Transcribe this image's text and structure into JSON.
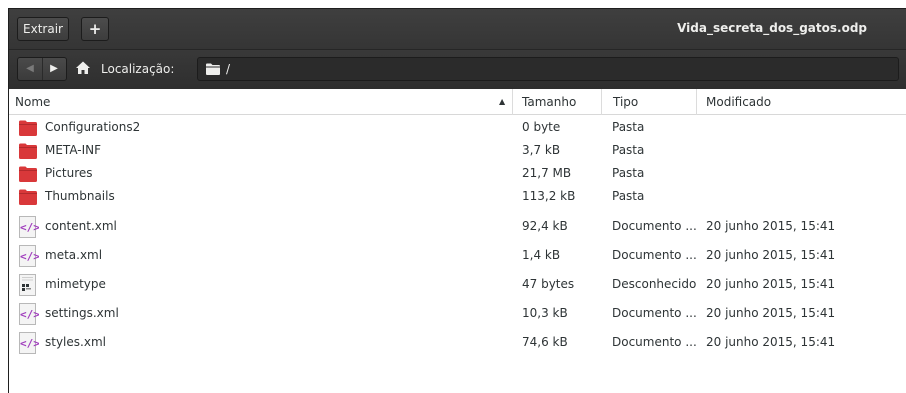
{
  "headerbar": {
    "extract_label": "Extrair",
    "add_label": "+",
    "title": "Vida_secreta_dos_gatos.odp"
  },
  "toolbar": {
    "location_label": "Localização:",
    "path": "/"
  },
  "columns": {
    "name": "Nome",
    "size": "Tamanho",
    "type": "Tipo",
    "modified": "Modificado"
  },
  "files": [
    {
      "name": "Configurations2",
      "size": "0 byte",
      "type": "Pasta",
      "modified": "",
      "icon": "folder-icon"
    },
    {
      "name": "META-INF",
      "size": "3,7 kB",
      "type": "Pasta",
      "modified": "",
      "icon": "folder-icon"
    },
    {
      "name": "Pictures",
      "size": "21,7 MB",
      "type": "Pasta",
      "modified": "",
      "icon": "folder-icon"
    },
    {
      "name": "Thumbnails",
      "size": "113,2 kB",
      "type": "Pasta",
      "modified": "",
      "icon": "folder-icon"
    },
    {
      "name": "content.xml",
      "size": "92,4 kB",
      "type": "Documento ...",
      "modified": "20 junho 2015, 15:41",
      "icon": "xml-file-icon"
    },
    {
      "name": "meta.xml",
      "size": "1,4 kB",
      "type": "Documento ...",
      "modified": "20 junho 2015, 15:41",
      "icon": "xml-file-icon"
    },
    {
      "name": "mimetype",
      "size": "47 bytes",
      "type": "Desconhecido",
      "modified": "20 junho 2015, 15:41",
      "icon": "binary-file-icon"
    },
    {
      "name": "settings.xml",
      "size": "10,3 kB",
      "type": "Documento ...",
      "modified": "20 junho 2015, 15:41",
      "icon": "xml-file-icon"
    },
    {
      "name": "styles.xml",
      "size": "74,6 kB",
      "type": "Documento ...",
      "modified": "20 junho 2015, 15:41",
      "icon": "xml-file-icon"
    }
  ],
  "colors": {
    "headerbar_bg": "#3a3a3a",
    "folder": "#d9383a",
    "xml_tag": "#a03dbd"
  }
}
